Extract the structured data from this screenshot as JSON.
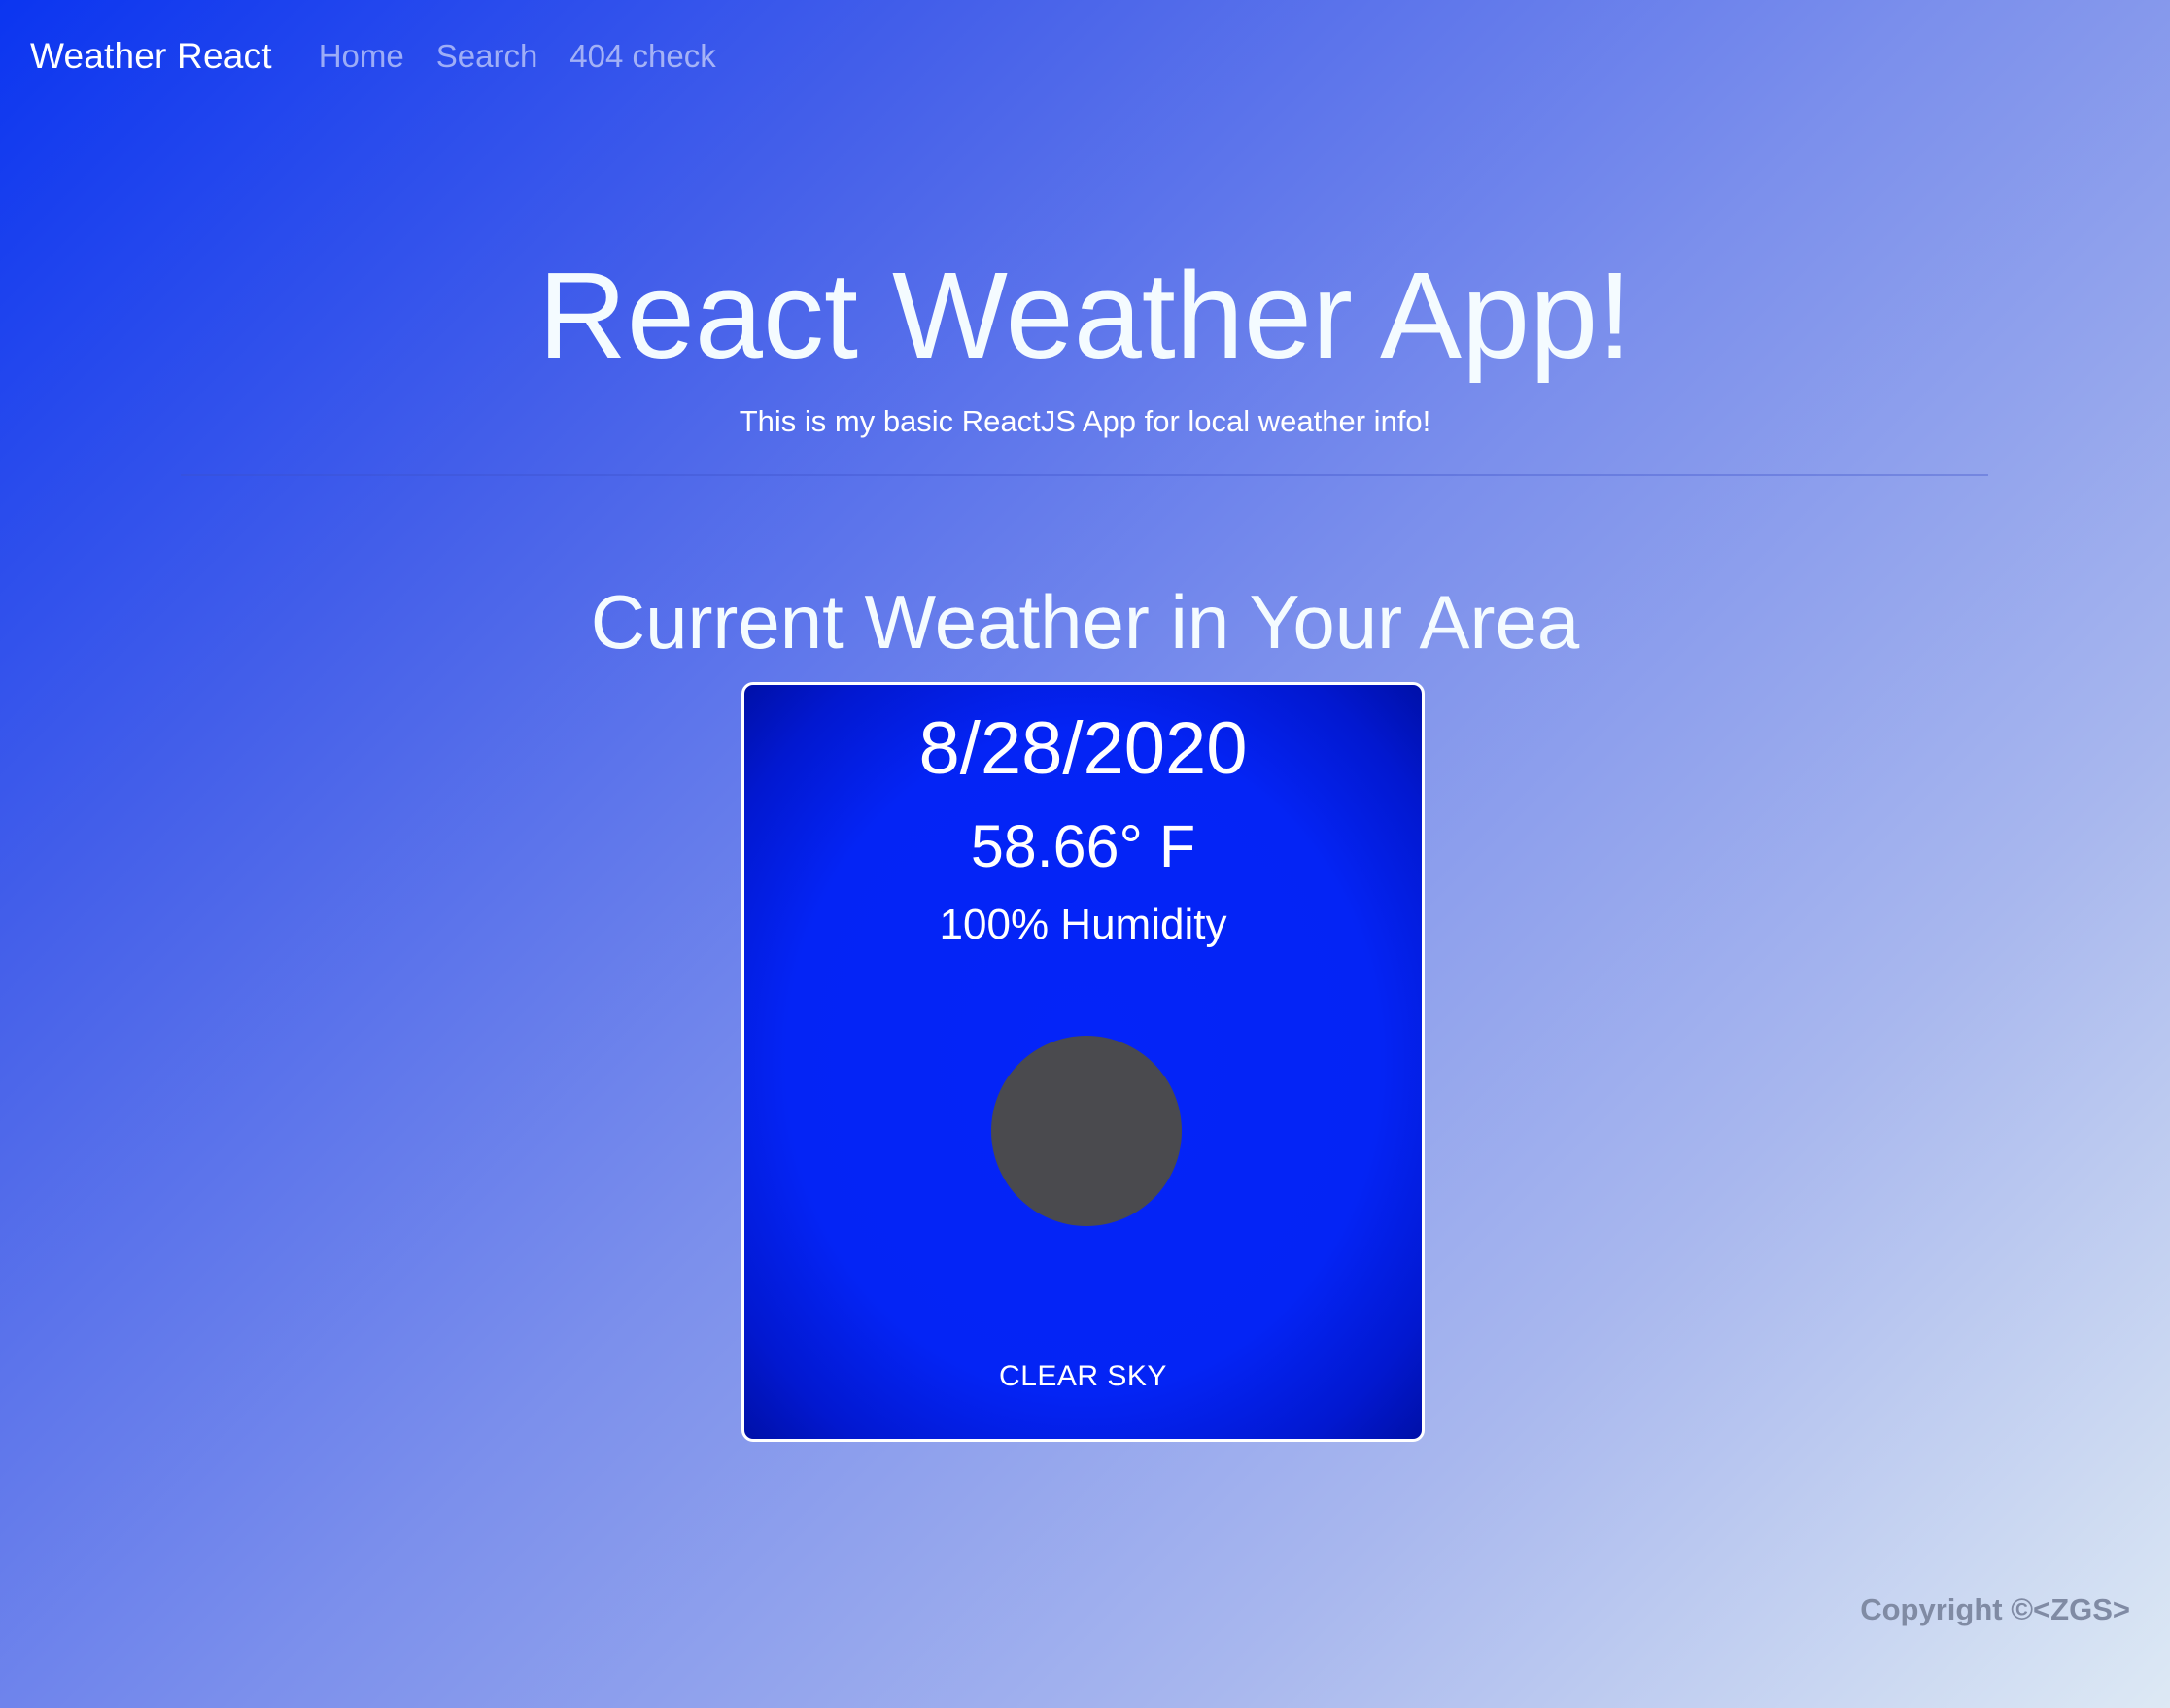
{
  "navbar": {
    "brand": "Weather React",
    "links": [
      "Home",
      "Search",
      "404 check"
    ]
  },
  "hero": {
    "title": "React Weather App!",
    "subtitle": "This is my basic ReactJS App for local weather info!"
  },
  "section": {
    "title": "Current Weather in Your Area"
  },
  "weather": {
    "date": "8/28/2020",
    "temperature": "58.66° F",
    "humidity": "100% Humidity",
    "condition": "CLEAR SKY",
    "icon": "weather-icon"
  },
  "footer": {
    "copyright": "Copyright ©<ZGS>"
  },
  "colors": {
    "card_background": "#0424f5",
    "icon_fill": "#4a4a4e",
    "footer_text": "#808ba4"
  }
}
